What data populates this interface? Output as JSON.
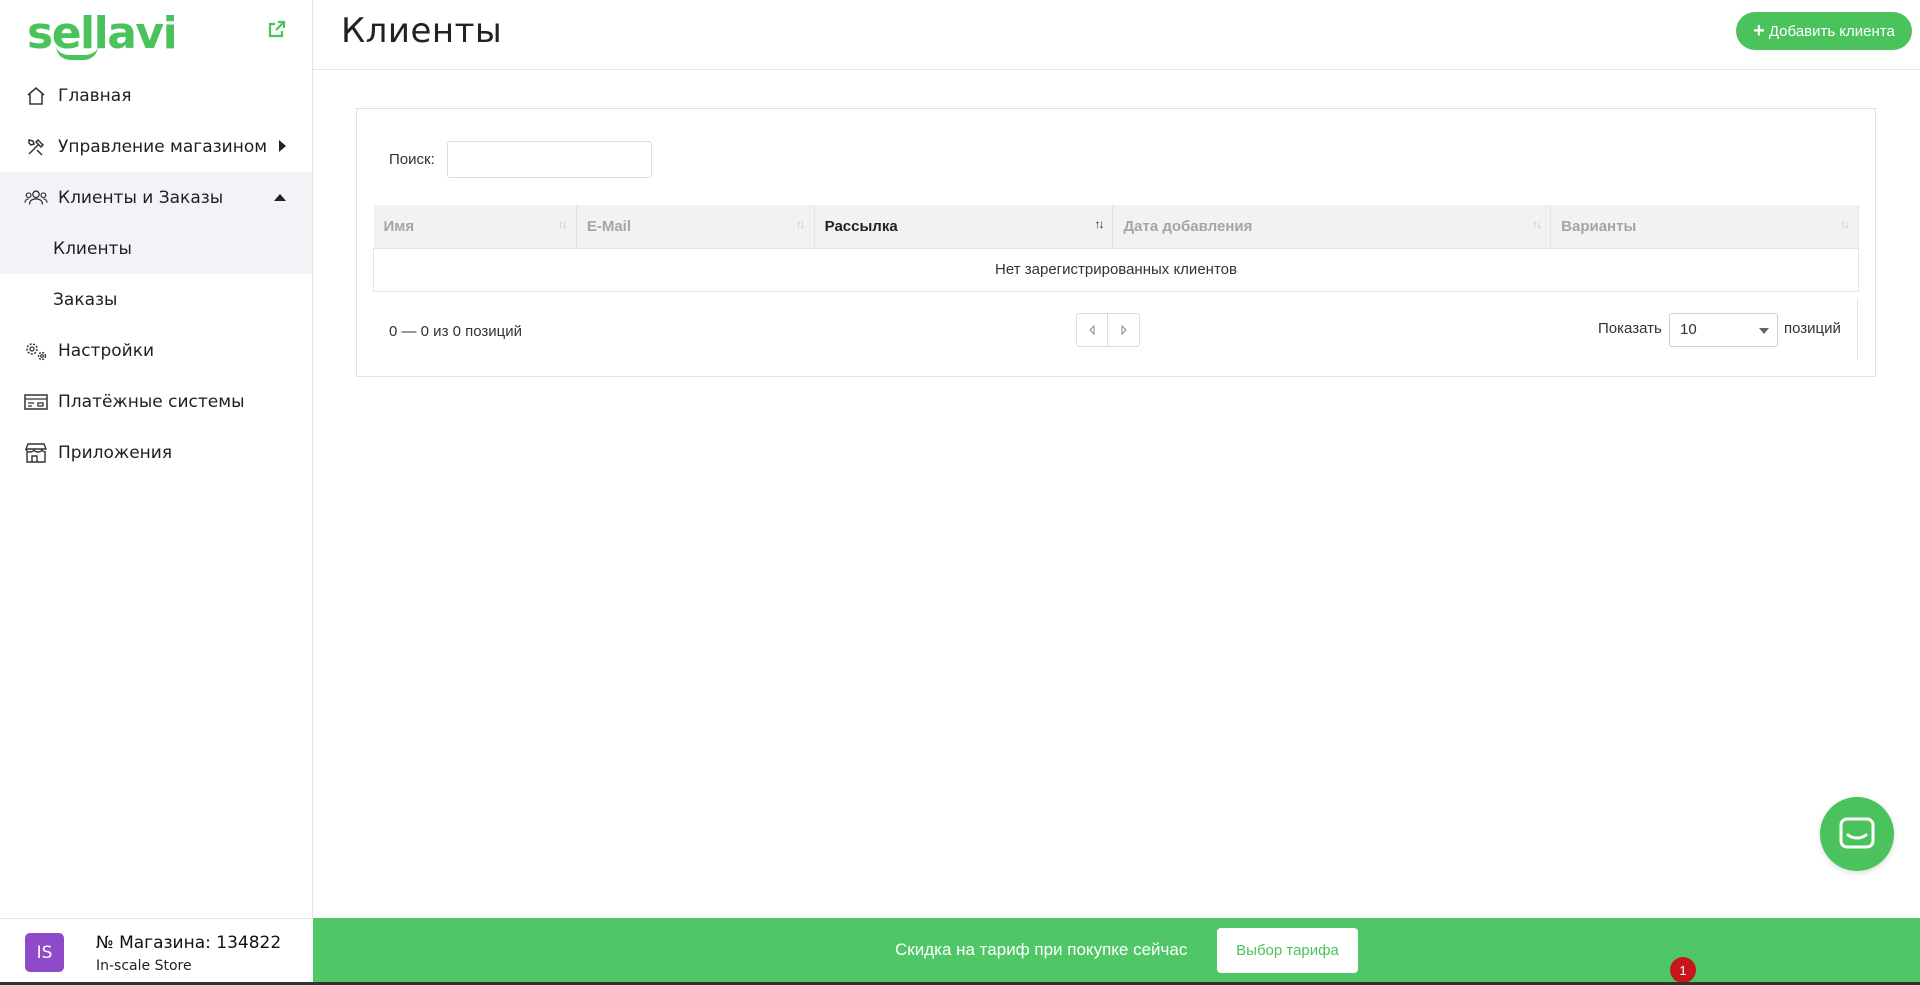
{
  "brand": {
    "name": "sellavi",
    "accent": "#4bc35c"
  },
  "sidebar": {
    "items": [
      {
        "label": "Главная",
        "icon": "home-icon"
      },
      {
        "label": "Управление магазином",
        "icon": "tools-icon"
      },
      {
        "label": "Клиенты и Заказы",
        "icon": "users-icon"
      },
      {
        "label": "Клиенты"
      },
      {
        "label": "Заказы"
      },
      {
        "label": "Настройки",
        "icon": "gears-icon"
      },
      {
        "label": "Платёжные системы",
        "icon": "payment-icon"
      },
      {
        "label": "Приложения",
        "icon": "store-icon"
      }
    ]
  },
  "store": {
    "avatar": "IS",
    "avatar_color": "#8f4ac9",
    "number_label": "№ Магазина: 134822",
    "name": "In-scale Store"
  },
  "header": {
    "title": "Клиенты",
    "add_button": "Добавить клиента"
  },
  "search": {
    "label": "Поиск:",
    "value": ""
  },
  "table": {
    "columns": [
      "Имя",
      "E-Mail",
      "Рассылка",
      "Дата добавления",
      "Варианты"
    ],
    "sorted_column": "Рассылка",
    "empty_message": "Нет зарегистрированных клиентов"
  },
  "pagination": {
    "info": "0 — 0 из 0 позиций",
    "show_label": "Показать",
    "page_size": "10",
    "suffix": "позиций"
  },
  "banner": {
    "text": "Скидка на тариф при покупке сейчас",
    "button": "Выбор тарифа",
    "color": "#4fc766"
  },
  "notification": {
    "count": "1"
  }
}
